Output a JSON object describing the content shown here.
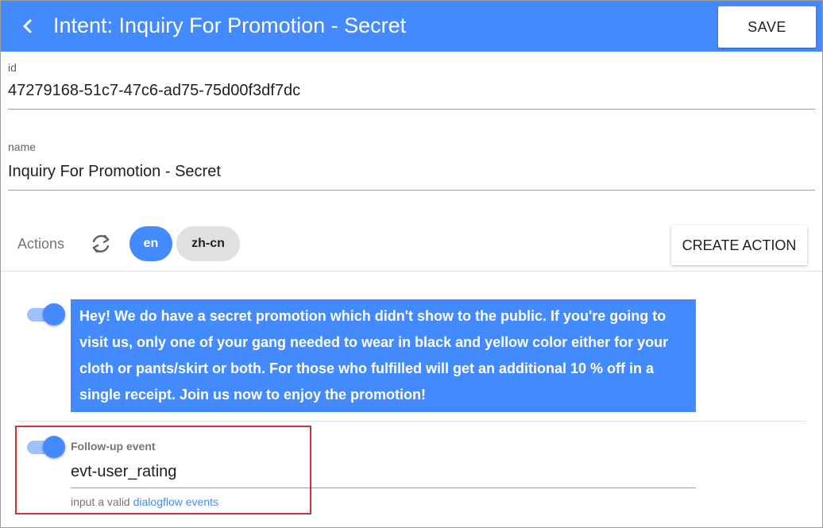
{
  "header": {
    "title": "Intent: Inquiry For Promotion - Secret",
    "save_label": "SAVE"
  },
  "fields": {
    "id": {
      "label": "id",
      "value": "47279168-51c7-47c6-ad75-75d00f3df7dc"
    },
    "name": {
      "label": "name",
      "value": "Inquiry For Promotion - Secret"
    }
  },
  "actions": {
    "label": "Actions",
    "languages": [
      "en",
      "zh-cn"
    ],
    "selected_language": "en",
    "create_label": "CREATE ACTION"
  },
  "action_item": {
    "enabled": true,
    "message": "Hey! We do have a secret promotion which didn't show to the public. If you're going to visit us, only one of your gang needed to wear in black and yellow color either for your cloth or pants/skirt or both. For those who fulfilled will get an additional 10 % off in a single receipt. Join us now to enjoy the promotion!"
  },
  "followup": {
    "enabled": true,
    "label": "Follow-up event",
    "value": "evt-user_rating",
    "hint_prefix": "input a valid",
    "hint_link": "dialogflow events"
  },
  "icons": {
    "back": "chevron-left-icon",
    "refresh": "refresh-icon"
  },
  "colors": {
    "primary": "#448aff",
    "highlight_border": "#d32f2f",
    "chip_inactive": "#e0e0e0"
  }
}
